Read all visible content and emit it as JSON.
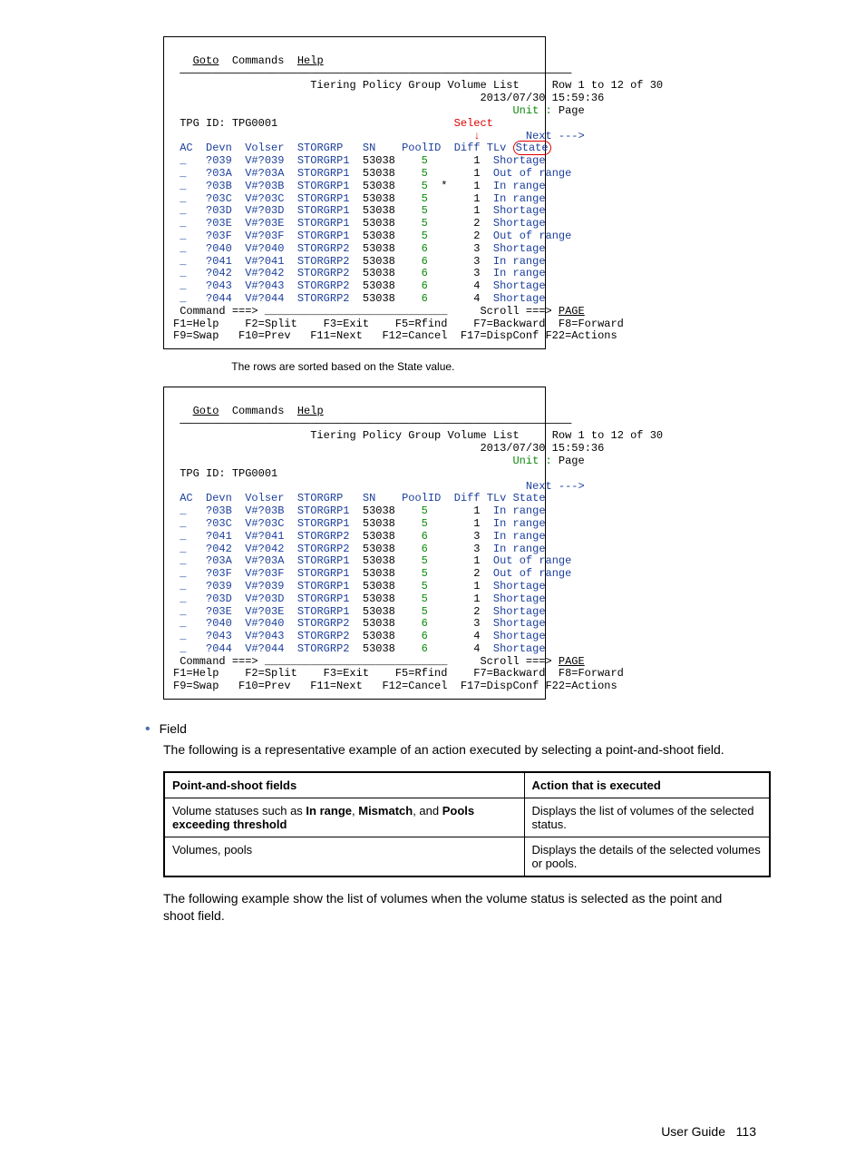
{
  "term1": {
    "menu": {
      "goto": "Goto",
      "commands": "Commands",
      "help": "Help"
    },
    "title": "Tiering Policy Group Volume List",
    "row_info": "Row 1 to 12 of 30",
    "timestamp": "2013/07/30 15:59:36",
    "unit_label": "Unit : ",
    "unit_value": "Page",
    "tpg_label": "TPG ID: ",
    "tpg_value": "TPG0001",
    "select_label": "Select",
    "next_label": "Next --->",
    "headers": [
      "AC",
      "Devn",
      "Volser",
      "STORGRP",
      "SN",
      "PoolID",
      "Diff",
      "TLv",
      "State"
    ],
    "rows": [
      [
        "_",
        "?039",
        "V#?039",
        "STORGRP1",
        "53038",
        "5",
        "",
        "1",
        "Shortage"
      ],
      [
        "_",
        "?03A",
        "V#?03A",
        "STORGRP1",
        "53038",
        "5",
        "",
        "1",
        "Out of range"
      ],
      [
        "_",
        "?03B",
        "V#?03B",
        "STORGRP1",
        "53038",
        "5",
        "*",
        "1",
        "In range"
      ],
      [
        "_",
        "?03C",
        "V#?03C",
        "STORGRP1",
        "53038",
        "5",
        "",
        "1",
        "In range"
      ],
      [
        "_",
        "?03D",
        "V#?03D",
        "STORGRP1",
        "53038",
        "5",
        "",
        "1",
        "Shortage"
      ],
      [
        "_",
        "?03E",
        "V#?03E",
        "STORGRP1",
        "53038",
        "5",
        "",
        "2",
        "Shortage"
      ],
      [
        "_",
        "?03F",
        "V#?03F",
        "STORGRP1",
        "53038",
        "5",
        "",
        "2",
        "Out of range"
      ],
      [
        "_",
        "?040",
        "V#?040",
        "STORGRP2",
        "53038",
        "6",
        "",
        "3",
        "Shortage"
      ],
      [
        "_",
        "?041",
        "V#?041",
        "STORGRP2",
        "53038",
        "6",
        "",
        "3",
        "In range"
      ],
      [
        "_",
        "?042",
        "V#?042",
        "STORGRP2",
        "53038",
        "6",
        "",
        "3",
        "In range"
      ],
      [
        "_",
        "?043",
        "V#?043",
        "STORGRP2",
        "53038",
        "6",
        "",
        "4",
        "Shortage"
      ],
      [
        "_",
        "?044",
        "V#?044",
        "STORGRP2",
        "53038",
        "6",
        "",
        "4",
        "Shortage"
      ]
    ],
    "cmd_label": "Command ===>",
    "scroll_label": "Scroll ===> ",
    "scroll_value": "PAGE",
    "fkeys1": "F1=Help    F2=Split    F3=Exit    F5=Rfind    F7=Backward  F8=Forward",
    "fkeys2": "F9=Swap   F10=Prev   F11=Next   F12=Cancel  F17=DispConf F22=Actions"
  },
  "caption": "The rows are sorted based on the State value.",
  "term2": {
    "menu": {
      "goto": "Goto",
      "commands": "Commands",
      "help": "Help"
    },
    "title": "Tiering Policy Group Volume List",
    "row_info": "Row 1 to 12 of 30",
    "timestamp": "2013/07/30 15:59:36",
    "unit_label": "Unit : ",
    "unit_value": "Page",
    "tpg_label": "TPG ID: ",
    "tpg_value": "TPG0001",
    "next_label": "Next --->",
    "headers": [
      "AC",
      "Devn",
      "Volser",
      "STORGRP",
      "SN",
      "PoolID",
      "Diff",
      "TLv",
      "State"
    ],
    "rows": [
      [
        "_",
        "?03B",
        "V#?03B",
        "STORGRP1",
        "53038",
        "5",
        "",
        "1",
        "In range"
      ],
      [
        "_",
        "?03C",
        "V#?03C",
        "STORGRP1",
        "53038",
        "5",
        "",
        "1",
        "In range"
      ],
      [
        "_",
        "?041",
        "V#?041",
        "STORGRP2",
        "53038",
        "6",
        "",
        "3",
        "In range"
      ],
      [
        "_",
        "?042",
        "V#?042",
        "STORGRP2",
        "53038",
        "6",
        "",
        "3",
        "In range"
      ],
      [
        "_",
        "?03A",
        "V#?03A",
        "STORGRP1",
        "53038",
        "5",
        "",
        "1",
        "Out of range"
      ],
      [
        "_",
        "?03F",
        "V#?03F",
        "STORGRP1",
        "53038",
        "5",
        "",
        "2",
        "Out of range"
      ],
      [
        "_",
        "?039",
        "V#?039",
        "STORGRP1",
        "53038",
        "5",
        "",
        "1",
        "Shortage"
      ],
      [
        "_",
        "?03D",
        "V#?03D",
        "STORGRP1",
        "53038",
        "5",
        "",
        "1",
        "Shortage"
      ],
      [
        "_",
        "?03E",
        "V#?03E",
        "STORGRP1",
        "53038",
        "5",
        "",
        "2",
        "Shortage"
      ],
      [
        "_",
        "?040",
        "V#?040",
        "STORGRP2",
        "53038",
        "6",
        "",
        "3",
        "Shortage"
      ],
      [
        "_",
        "?043",
        "V#?043",
        "STORGRP2",
        "53038",
        "6",
        "",
        "4",
        "Shortage"
      ],
      [
        "_",
        "?044",
        "V#?044",
        "STORGRP2",
        "53038",
        "6",
        "",
        "4",
        "Shortage"
      ]
    ],
    "cmd_label": "Command ===>",
    "scroll_label": "Scroll ===> ",
    "scroll_value": "PAGE",
    "fkeys1": "F1=Help    F2=Split    F3=Exit    F5=Rfind    F7=Backward  F8=Forward",
    "fkeys2": "F9=Swap   F10=Prev   F11=Next   F12=Cancel  F17=DispConf F22=Actions"
  },
  "bullet_field": "Field",
  "paragraph1": "The following is a representative example of an action executed by selecting a point-and-shoot field.",
  "table": {
    "h1": "Point-and-shoot fields",
    "h2": "Action that is executed",
    "r1c1a": "Volume statuses such as ",
    "r1c1b": "In range",
    "r1c1c": ", ",
    "r1c1d": "Mismatch",
    "r1c1e": ", and ",
    "r1c1f": "Pools exceeding threshold",
    "r1c2": "Displays the list of volumes of the selected status.",
    "r2c1": "Volumes, pools",
    "r2c2": "Displays the details of the selected volumes or pools."
  },
  "paragraph2": "The following example show the list of volumes when the volume status is selected as the point and shoot field.",
  "footer": {
    "label": "User Guide",
    "page": "113"
  }
}
